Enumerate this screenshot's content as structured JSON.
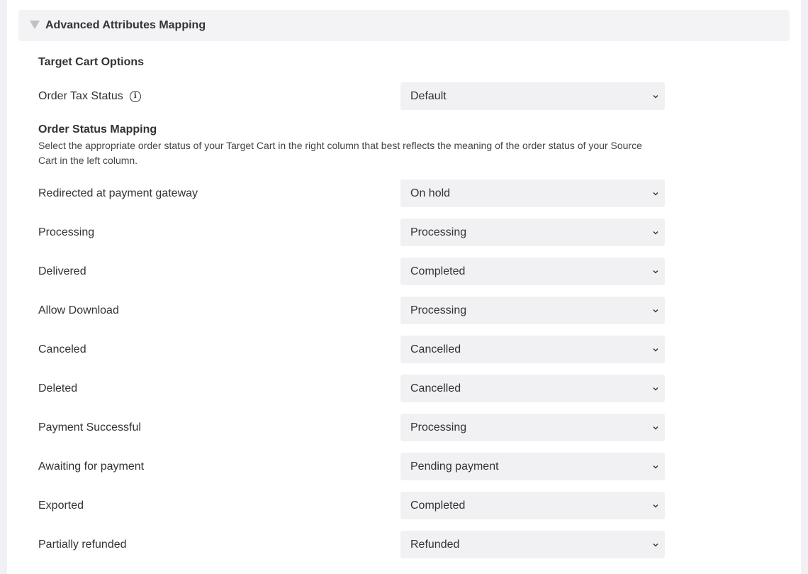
{
  "section": {
    "title": "Advanced Attributes Mapping"
  },
  "target_cart": {
    "heading": "Target Cart Options",
    "tax_status": {
      "label": "Order Tax Status",
      "value": "Default"
    }
  },
  "order_status": {
    "heading": "Order Status Mapping",
    "description": "Select the appropriate order status of your Target Cart in the right column that best reflects the meaning of the order status of your Source Cart in the left column.",
    "rows": [
      {
        "label": "Redirected at payment gateway",
        "value": "On hold"
      },
      {
        "label": "Processing",
        "value": "Processing"
      },
      {
        "label": "Delivered",
        "value": "Completed"
      },
      {
        "label": "Allow Download",
        "value": "Processing"
      },
      {
        "label": "Canceled",
        "value": "Cancelled"
      },
      {
        "label": "Deleted",
        "value": "Cancelled"
      },
      {
        "label": "Payment Successful",
        "value": "Processing"
      },
      {
        "label": "Awaiting for payment",
        "value": "Pending payment"
      },
      {
        "label": "Exported",
        "value": "Completed"
      },
      {
        "label": "Partially refunded",
        "value": "Refunded"
      }
    ]
  }
}
